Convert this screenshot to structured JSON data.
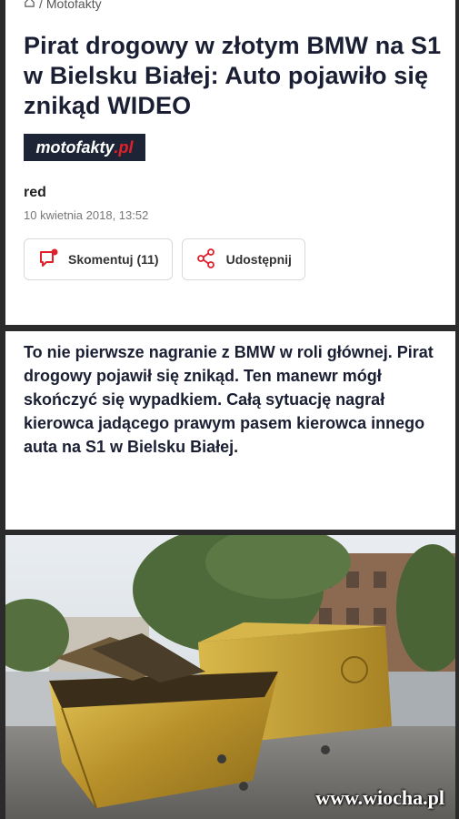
{
  "breadcrumb": {
    "home_icon": "home-icon",
    "separator": "/",
    "section": "Motofakty"
  },
  "article": {
    "title": "Pirat drogowy w złotym BMW na S1 w Bielsku Białej: Auto pojawiło się znikąd WIDEO",
    "logo_main": "motofakty",
    "logo_suffix": ".pl",
    "author": "red",
    "date": "10 kwietnia 2018, 13:52",
    "comment_label": "Skomentuj (11)",
    "share_label": "Udostępnij",
    "lead": "To nie pierwsze nagranie z BMW w roli głównej. Pirat drogowy pojawił się znikąd. Ten manewr mógł skończyć się wypadkiem. Całą sytuację nagrał kierowca jadącego prawym pasem kierowca innego auta na S1 w Bielsku Białej."
  },
  "photo": {
    "watermark": "www.wiocha.pl"
  },
  "colors": {
    "title": "#1a1f33",
    "logo_bg": "#1c2436",
    "logo_accent": "#e0202a",
    "comment_icon": "#e0202a",
    "share_icon": "#e0202a",
    "gold": "#c9a43a"
  }
}
